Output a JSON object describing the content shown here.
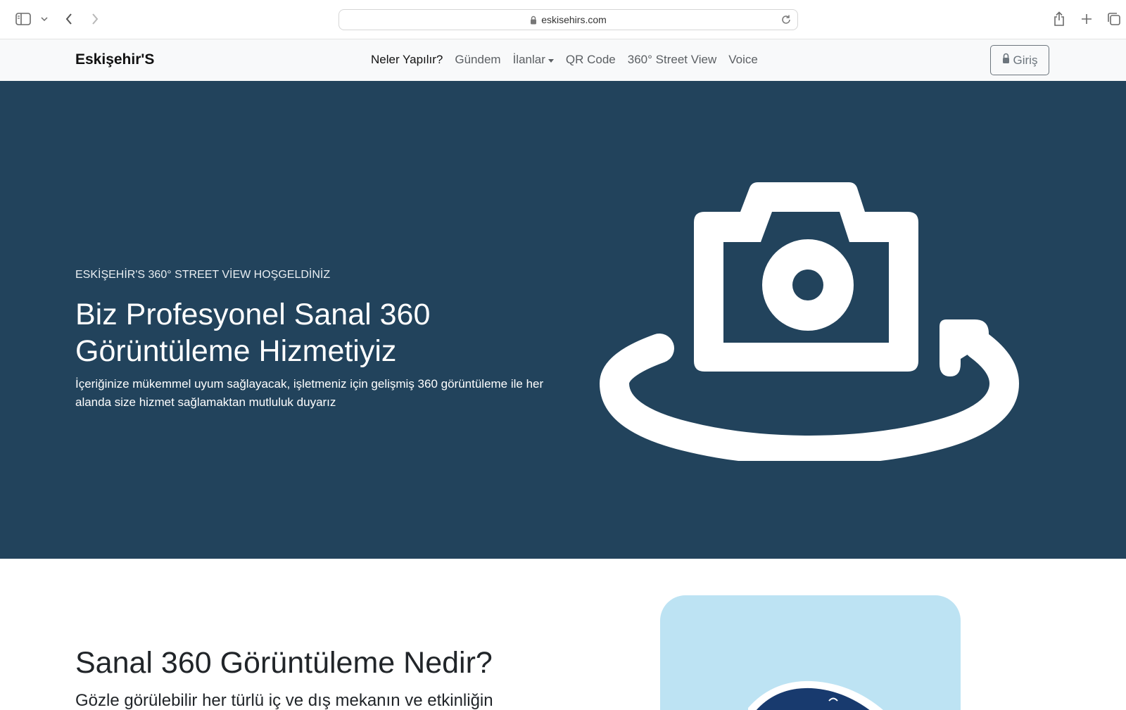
{
  "browser": {
    "url": "eskisehirs.com",
    "icons": {
      "sidebar": "sidebar-icon",
      "dropdown": "chevron-down-icon",
      "back": "back-arrow-icon",
      "forward": "forward-arrow-icon",
      "lock": "lock-icon",
      "reload": "reload-icon",
      "share": "share-icon",
      "new_tab": "plus-icon",
      "tabs": "tabs-overview-icon"
    }
  },
  "navbar": {
    "brand": "Eskişehir'S",
    "items": [
      {
        "label": "Neler Yapılır?",
        "active": true
      },
      {
        "label": "Gündem"
      },
      {
        "label": "İlanlar",
        "dropdown": true
      },
      {
        "label": "QR Code"
      },
      {
        "label": "360° Street View"
      },
      {
        "label": "Voice"
      }
    ],
    "login_label": "Giriş",
    "login_icon": "lock-icon"
  },
  "hero": {
    "eyebrow": "ESKİŞEHİR'S 360° STREET VİEW HOŞGELDİNİZ",
    "title": "Biz Profesyonel Sanal 360 Görüntüleme Hizmetiyiz",
    "text": "İçeriğinize mükemmel uyum sağlayacak, işletmeniz için gelişmiş 360 görüntüleme ile her alanda size hizmet sağlamaktan mutluluk duyarız",
    "illustration": "camera-360-icon",
    "background": "#22435c"
  },
  "section2": {
    "title": "Sanal 360 Görüntüleme Nedir?",
    "text": "Gözle görülebilir her türlü iç ve dış mekanın ve etkinliğin",
    "card_color": "#bde3f3"
  }
}
